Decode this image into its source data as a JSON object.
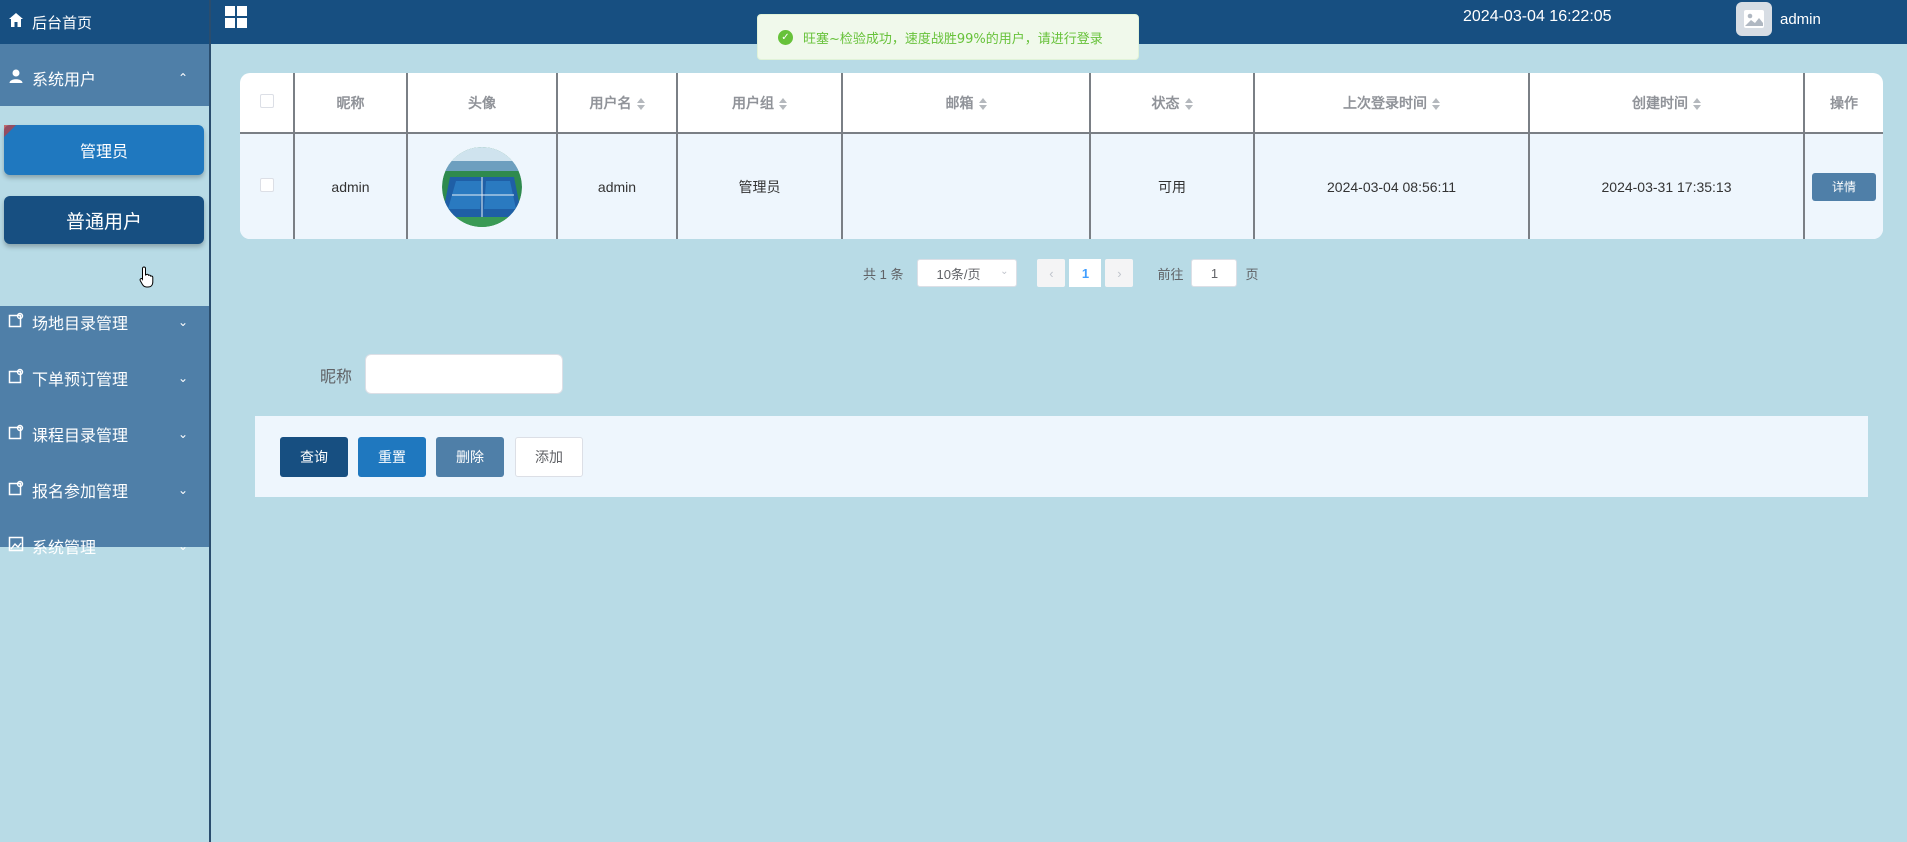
{
  "header": {
    "home_label": "后台首页",
    "app_title": "",
    "datetime": "2024-03-04 16:22:05",
    "username": "admin",
    "colors": {
      "topbar": "#174f81",
      "sidebar": "#4f7fa8",
      "background": "#b8dbe6"
    }
  },
  "toast": {
    "message": "旺塞~检验成功，速度战胜99%的用户，请进行登录",
    "type": "success"
  },
  "sidebar": {
    "groups": [
      {
        "label": "系统用户",
        "icon": "user-icon",
        "expanded": true
      },
      {
        "label": "场地目录管理",
        "icon": "folder-icon",
        "expanded": false
      },
      {
        "label": "下单预订管理",
        "icon": "folder-icon",
        "expanded": false
      },
      {
        "label": "课程目录管理",
        "icon": "folder-icon",
        "expanded": false
      },
      {
        "label": "报名参加管理",
        "icon": "folder-icon",
        "expanded": false
      },
      {
        "label": "系统管理",
        "icon": "image-icon",
        "expanded": false
      }
    ],
    "subitems": [
      "管理员",
      "普通用户"
    ],
    "active_subitem": "普通用户"
  },
  "table": {
    "columns": [
      "昵称",
      "头像",
      "用户名",
      "用户组",
      "邮箱",
      "状态",
      "上次登录时间",
      "创建时间",
      "操作"
    ],
    "rows": [
      {
        "nickname": "admin",
        "avatar": "tennis-court-avatar",
        "username": "admin",
        "group": "管理员",
        "email": "",
        "status": "可用",
        "last_login": "2024-03-04 08:56:11",
        "created": "2024-03-31 17:35:13",
        "action": "详情"
      }
    ]
  },
  "pagination": {
    "total_text": "共 1 条",
    "page_size": "10条/页",
    "current_page": "1",
    "goto_label": "前往",
    "goto_value": "1",
    "page_unit": "页"
  },
  "search": {
    "nickname_label": "昵称",
    "nickname_value": ""
  },
  "actions": {
    "query": "查询",
    "reset": "重置",
    "delete": "删除",
    "add": "添加"
  }
}
